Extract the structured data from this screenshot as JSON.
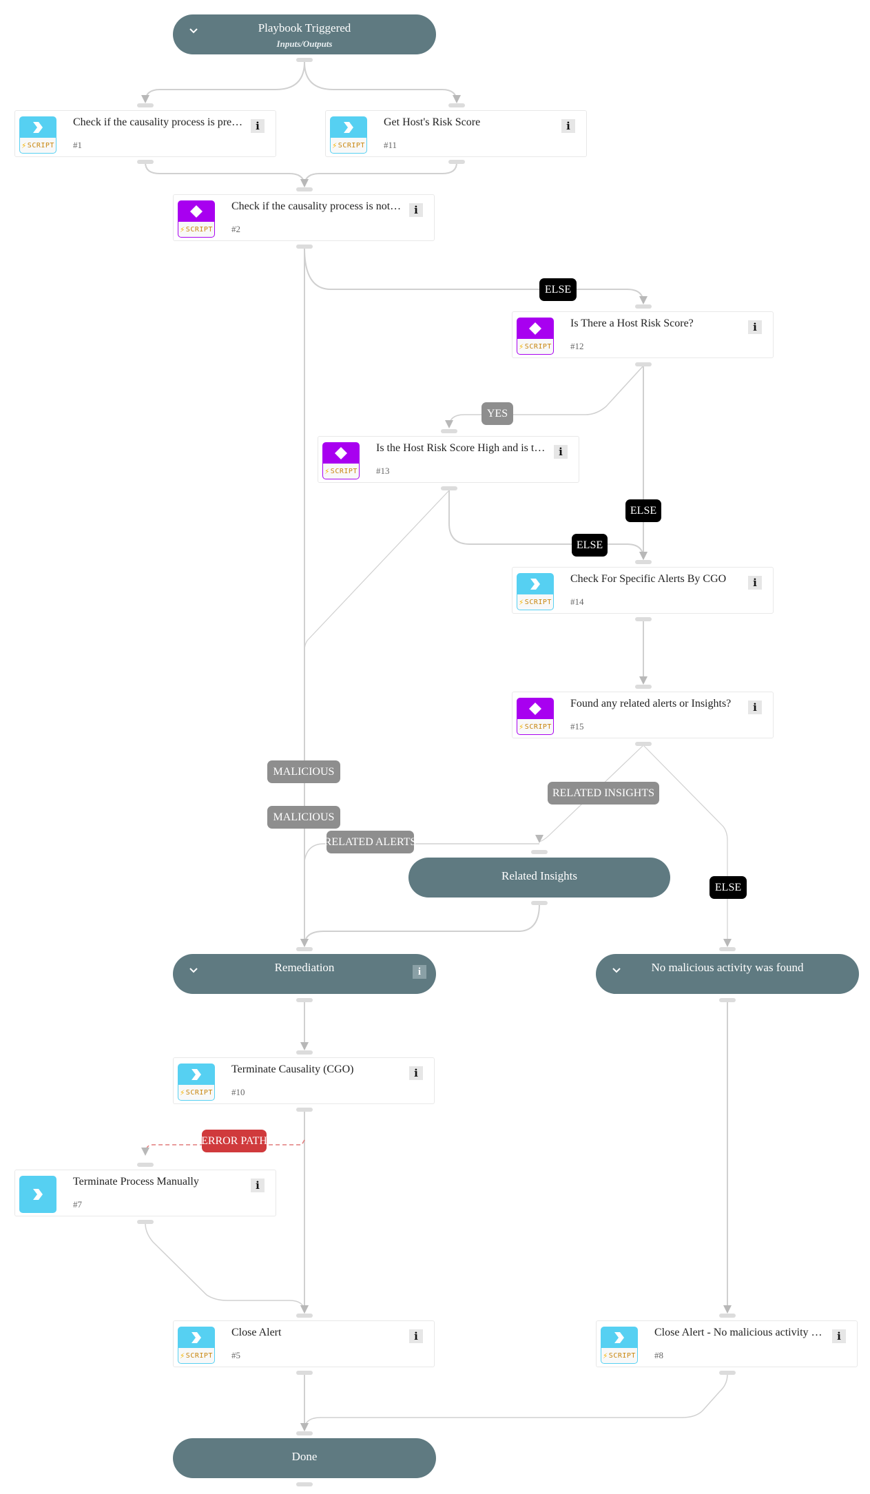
{
  "colors": {
    "pill": "#5f7a81",
    "script_badge": "#56d0f2",
    "condition_badge": "#a800f0",
    "else_label": "#000000",
    "branch_label": "#8e8e8e",
    "error_label": "#d03a3c",
    "edge": "#cfcfcf"
  },
  "start": {
    "title": "Playbook Triggered",
    "subtitle": "Inputs/Outputs",
    "icon": "chevron-down-icon"
  },
  "tasks": {
    "t1": {
      "name": "Check if the causality process is prevalent",
      "name_shown": "Check if the causality process is prev…",
      "number": "#1",
      "type": "script",
      "badge_label": "SCRIPT",
      "icon": "chevron-right-icon"
    },
    "t11": {
      "name": "Get Host's Risk Score",
      "number": "#11",
      "type": "script",
      "badge_label": "SCRIPT",
      "icon": "chevron-right-icon"
    },
    "t2": {
      "name": "Check if the causality process is not p…",
      "number": "#2",
      "type": "condition",
      "badge_label": "SCRIPT",
      "icon": "diamond-icon"
    },
    "t12": {
      "name": "Is There a Host Risk Score?",
      "number": "#12",
      "type": "condition",
      "badge_label": "SCRIPT",
      "icon": "diamond-icon"
    },
    "t13": {
      "name": "Is the Host Risk Score High and is th…",
      "number": "#13",
      "type": "condition",
      "badge_label": "SCRIPT",
      "icon": "diamond-icon"
    },
    "t14": {
      "name": "Check For Specific Alerts By CGO",
      "number": "#14",
      "type": "script",
      "badge_label": "SCRIPT",
      "icon": "chevron-right-icon"
    },
    "t15": {
      "name": "Found any related alerts or Insights?",
      "number": "#15",
      "type": "condition",
      "badge_label": "SCRIPT",
      "icon": "diamond-icon"
    },
    "t10": {
      "name": "Terminate Causality (CGO)",
      "number": "#10",
      "type": "script",
      "badge_label": "SCRIPT",
      "icon": "chevron-right-icon"
    },
    "t7": {
      "name": "Terminate Process Manually",
      "number": "#7",
      "type": "manual",
      "icon": "chevron-right-icon"
    },
    "t5": {
      "name": "Close Alert",
      "number": "#5",
      "type": "script",
      "badge_label": "SCRIPT",
      "icon": "chevron-right-icon"
    },
    "t8": {
      "name": "Close Alert - No malicious activity w…",
      "number": "#8",
      "type": "script",
      "badge_label": "SCRIPT",
      "icon": "chevron-right-icon"
    }
  },
  "sections": {
    "related_insights": {
      "title": "Related Insights"
    },
    "remediation": {
      "title": "Remediation",
      "icon": "chevron-down-icon",
      "info": "i"
    },
    "no_malicious": {
      "title": "No malicious activity was found",
      "icon": "chevron-down-icon"
    },
    "done": {
      "title": "Done"
    }
  },
  "info_glyph": "i",
  "edge_labels": {
    "else_2_12": "ELSE",
    "yes_12_13": "YES",
    "else_12_14": "ELSE",
    "else_13_14": "ELSE",
    "malicious_2": "MALICIOUS",
    "malicious_13": "MALICIOUS",
    "related_alerts": "RELATED ALERTS",
    "related_insights": "RELATED INSIGHTS",
    "else_15": "ELSE",
    "error_path": "ERROR PATH"
  }
}
